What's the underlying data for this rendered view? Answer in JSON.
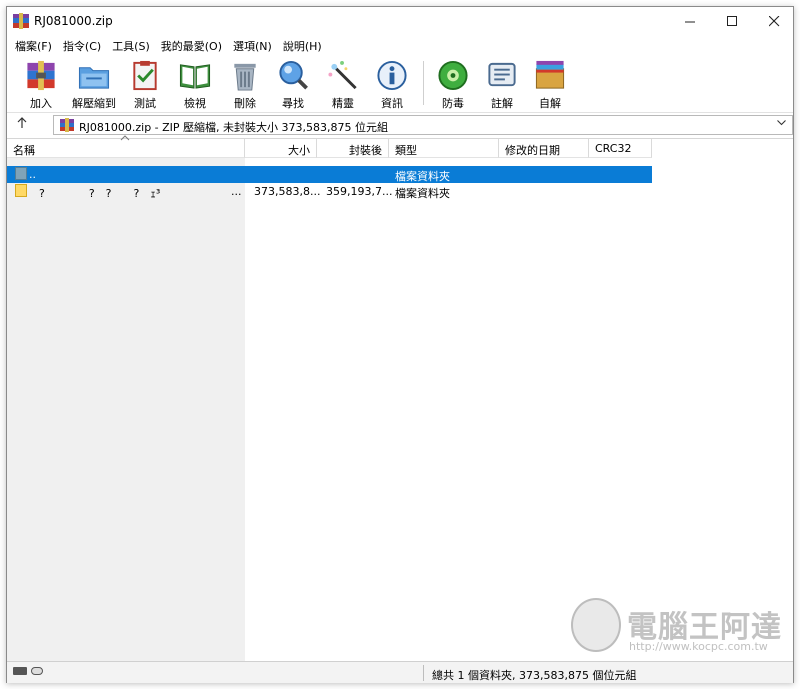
{
  "window": {
    "title": "RJ081000.zip"
  },
  "menu": [
    "檔案(F)",
    "指令(C)",
    "工具(S)",
    "我的最愛(O)",
    "選項(N)",
    "說明(H)"
  ],
  "toolbar": [
    {
      "label": "加入",
      "icon": "add-archive-icon"
    },
    {
      "label": "解壓縮到",
      "icon": "extract-folder-icon"
    },
    {
      "label": "測試",
      "icon": "test-clipboard-icon"
    },
    {
      "label": "檢視",
      "icon": "view-book-icon"
    },
    {
      "label": "刪除",
      "icon": "trash-icon"
    },
    {
      "label": "尋找",
      "icon": "magnifier-icon"
    },
    {
      "label": "精靈",
      "icon": "wizard-wand-icon"
    },
    {
      "label": "資訊",
      "icon": "info-icon"
    },
    {
      "label": "防毒",
      "icon": "antivirus-icon"
    },
    {
      "label": "註解",
      "icon": "comment-icon"
    },
    {
      "label": "自解",
      "icon": "sfx-box-icon"
    }
  ],
  "address": {
    "text": "RJ081000.zip - ZIP 壓縮檔, 未封裝大小 373,583,875 位元組"
  },
  "columns": [
    "名稱",
    "大小",
    "封裝後",
    "類型",
    "修改的日期",
    "CRC32"
  ],
  "rows": [
    {
      "name": "..",
      "size": "",
      "packed": "",
      "type": "檔案資料夾",
      "modified": "",
      "crc": ""
    },
    {
      "name": "?　　　　?　?　　?　ｪ³",
      "ellipsis": "...",
      "size": "373,583,8...",
      "packed": "359,193,7...",
      "type": "檔案資料夾",
      "modified": "",
      "crc": ""
    }
  ],
  "watermark": {
    "title": "電腦王阿達",
    "url": "http://www.kocpc.com.tw"
  },
  "status": {
    "text": "總共 1 個資料夾, 373,583,875 個位元組"
  },
  "colors": {
    "selection": "#0a7cd6"
  }
}
